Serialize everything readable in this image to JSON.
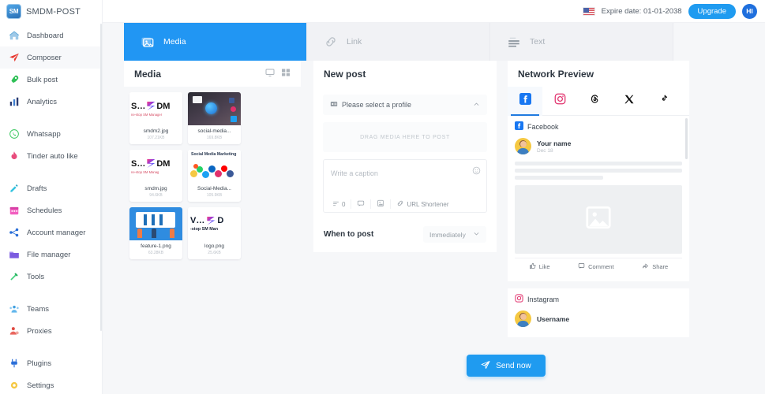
{
  "brand": {
    "mark": "SM",
    "name": "SMDM-POST"
  },
  "topbar": {
    "expire": "Expire date: 01-01-2038",
    "upgrade_label": "Upgrade",
    "avatar_initials": "HI",
    "flag_icon": "us-flag-icon"
  },
  "sidebar": {
    "items": [
      {
        "label": "Dashboard",
        "icon": "home-icon",
        "active": false
      },
      {
        "label": "Composer",
        "icon": "paper-plane-icon",
        "active": true
      },
      {
        "label": "Bulk post",
        "icon": "rocket-icon",
        "active": false
      },
      {
        "label": "Analytics",
        "icon": "bar-chart-icon",
        "active": false
      },
      {
        "label": "Whatsapp",
        "icon": "whatsapp-icon",
        "active": false
      },
      {
        "label": "Tinder auto like",
        "icon": "flame-icon",
        "active": false
      },
      {
        "label": "Drafts",
        "icon": "pencil-icon",
        "active": false
      },
      {
        "label": "Schedules",
        "icon": "calendar-icon",
        "active": false
      },
      {
        "label": "Account manager",
        "icon": "share-nodes-icon",
        "active": false
      },
      {
        "label": "File manager",
        "icon": "folder-icon",
        "active": false
      },
      {
        "label": "Tools",
        "icon": "wrench-icon",
        "active": false
      },
      {
        "label": "Teams",
        "icon": "users-icon",
        "active": false
      },
      {
        "label": "Proxies",
        "icon": "user-shield-icon",
        "active": false
      },
      {
        "label": "Plugins",
        "icon": "plug-icon",
        "active": false
      },
      {
        "label": "Settings",
        "icon": "gear-icon",
        "active": false
      }
    ]
  },
  "tabs": [
    {
      "label": "Media",
      "icon": "image-icon",
      "active": true
    },
    {
      "label": "Link",
      "icon": "link-icon",
      "active": false
    },
    {
      "label": "Text",
      "icon": "text-lines-icon",
      "active": false
    }
  ],
  "media": {
    "title": "Media",
    "view_icons": [
      "monitor-icon",
      "grid-icon"
    ],
    "files": [
      {
        "name": "smdm2.jpg",
        "size": "107.21KB",
        "art": "smdm",
        "caption": "ne-stop SM Manager"
      },
      {
        "name": "social-media...",
        "size": "169.8KB",
        "art": "photo",
        "caption": ""
      },
      {
        "name": "smdm.jpg",
        "size": "94.6KB",
        "art": "smdm",
        "caption": "ne-stop SM Manag"
      },
      {
        "name": "Social-Media...",
        "size": "105.9KB",
        "art": "social",
        "caption": "Social Media Marketing"
      },
      {
        "name": "feature-1.png",
        "size": "63.28KB",
        "art": "feature",
        "caption": ""
      },
      {
        "name": "logo.png",
        "size": "25.6KB",
        "art": "logo",
        "caption": "-stop SM Man"
      }
    ]
  },
  "new_post": {
    "title": "New post",
    "profile_placeholder": "Please select a profile",
    "profile_icon": "profile-card-icon",
    "chevron_icon": "chevron-up-icon",
    "dropzone_text": "DRAG MEDIA HERE TO POST",
    "caption_placeholder": "Write a caption",
    "emoji_icon": "emoji-icon",
    "tools": [
      {
        "label": "0",
        "icon": "character-count-icon"
      },
      {
        "label": "",
        "icon": "comment-icon"
      },
      {
        "label": "",
        "icon": "image-file-icon"
      },
      {
        "label": "URL Shortener",
        "icon": "link-icon"
      }
    ],
    "when_label": "When to post",
    "when_value": "Immediately",
    "send_label": "Send now",
    "send_icon": "send-icon"
  },
  "preview": {
    "title": "Network Preview",
    "network_tabs": [
      {
        "name": "facebook",
        "icon": "facebook-icon",
        "active": true
      },
      {
        "name": "instagram",
        "icon": "instagram-icon",
        "active": false
      },
      {
        "name": "threads",
        "icon": "threads-icon",
        "active": false
      },
      {
        "name": "x",
        "icon": "x-twitter-icon",
        "active": false
      },
      {
        "name": "tiktok",
        "icon": "tiktok-icon",
        "active": false
      }
    ],
    "facebook": {
      "network_label": "Facebook",
      "user_name": "Your name",
      "date": "Dec 18",
      "image_placeholder_icon": "image-placeholder-icon",
      "actions": [
        {
          "label": "Like",
          "icon": "thumbs-up-icon"
        },
        {
          "label": "Comment",
          "icon": "comment-icon"
        },
        {
          "label": "Share",
          "icon": "share-icon"
        }
      ]
    },
    "instagram": {
      "network_label": "Instagram",
      "user_name": "Username"
    }
  },
  "colors": {
    "accent": "#1f9bf0",
    "tab_active": "#2196f3",
    "page_bg": "#f6f7f9"
  }
}
